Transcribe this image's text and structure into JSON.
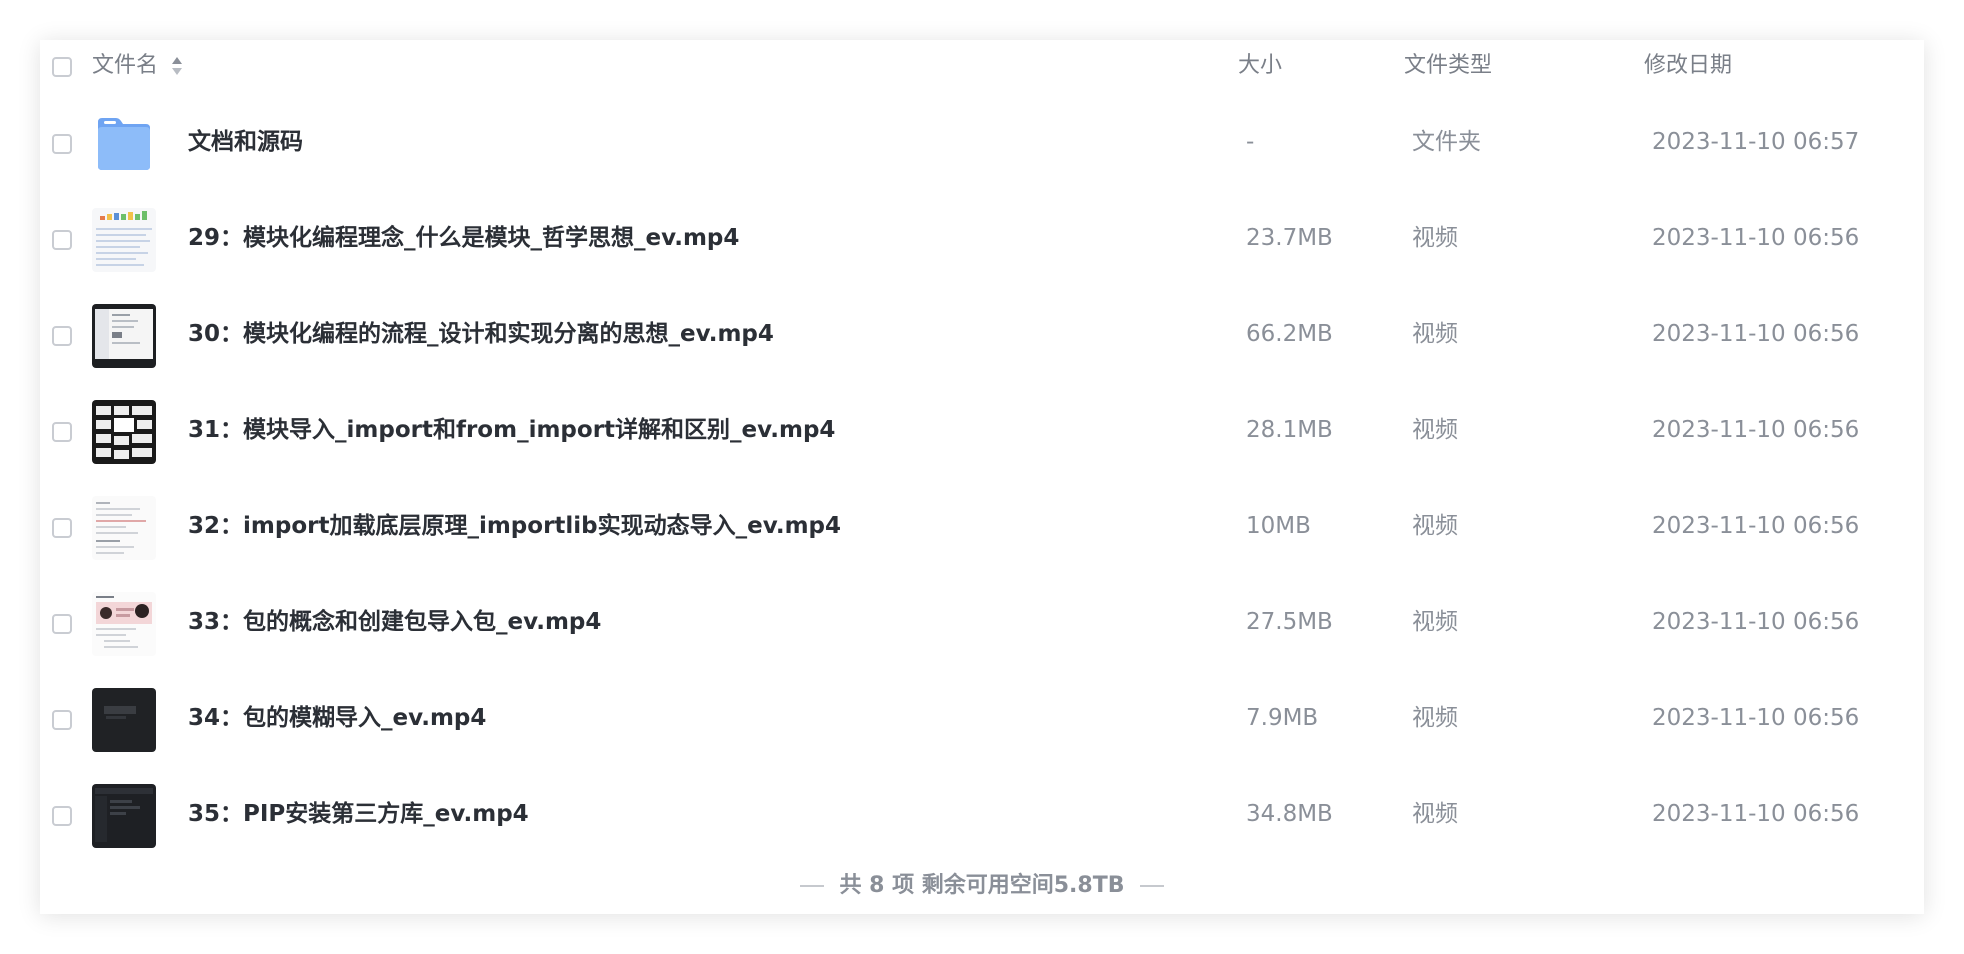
{
  "header": {
    "name_label": "文件名",
    "size_label": "大小",
    "type_label": "文件类型",
    "date_label": "修改日期"
  },
  "rows": [
    {
      "name": "文档和源码",
      "size": "-",
      "type": "文件夹",
      "date": "2023-11-10 06:57",
      "icon": "folder-icon"
    },
    {
      "name": "29：模块化编程理念_什么是模块_哲学思想_ev.mp4",
      "size": "23.7MB",
      "type": "视频",
      "date": "2023-11-10 06:56",
      "icon": "video-thumbnail"
    },
    {
      "name": "30：模块化编程的流程_设计和实现分离的思想_ev.mp4",
      "size": "66.2MB",
      "type": "视频",
      "date": "2023-11-10 06:56",
      "icon": "video-thumbnail"
    },
    {
      "name": "31：模块导入_import和from_import详解和区别_ev.mp4",
      "size": "28.1MB",
      "type": "视频",
      "date": "2023-11-10 06:56",
      "icon": "video-thumbnail"
    },
    {
      "name": "32：import加载底层原理_importlib实现动态导入_ev.mp4",
      "size": "10MB",
      "type": "视频",
      "date": "2023-11-10 06:56",
      "icon": "video-thumbnail"
    },
    {
      "name": "33：包的概念和创建包导入包_ev.mp4",
      "size": "27.5MB",
      "type": "视频",
      "date": "2023-11-10 06:56",
      "icon": "video-thumbnail"
    },
    {
      "name": "34：包的模糊导入_ev.mp4",
      "size": "7.9MB",
      "type": "视频",
      "date": "2023-11-10 06:56",
      "icon": "video-thumbnail"
    },
    {
      "name": "35：PIP安装第三方库_ev.mp4",
      "size": "34.8MB",
      "type": "视频",
      "date": "2023-11-10 06:56",
      "icon": "video-thumbnail"
    }
  ],
  "footer": {
    "summary": "共 8 项 剩余可用空间5.8TB"
  },
  "colors": {
    "folder": "#7fb2f7",
    "text_primary": "#2b2f36",
    "text_secondary": "#8a8f98"
  }
}
